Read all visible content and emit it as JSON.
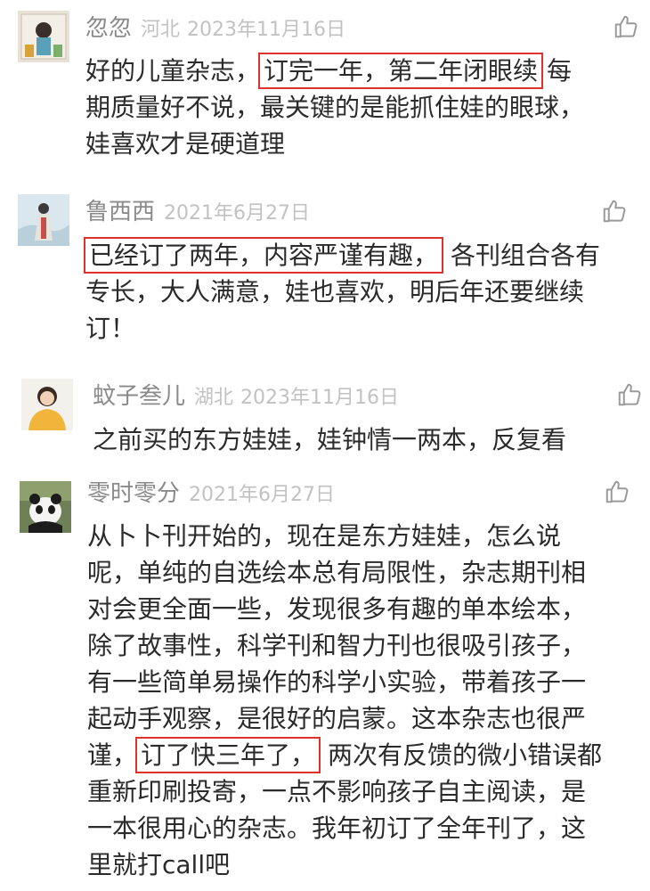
{
  "comments": [
    {
      "name": "忽忽",
      "location": "河北",
      "date": "2023年11月16日",
      "lines": [
        {
          "pre": "好的儿童杂志，",
          "hl": "订完一年，第二年闭眼续",
          "post": "每"
        },
        {
          "pre": "期质量好不说，最关键的是能抓住娃的眼球，",
          "hl": "",
          "post": ""
        },
        {
          "pre": "娃喜欢才是硬道理",
          "hl": "",
          "post": ""
        }
      ]
    },
    {
      "name": "鲁西西",
      "location": "",
      "date": "2021年6月27日",
      "lines": [
        {
          "pre": "",
          "hl": "已经订了两年，内容严谨有趣，",
          "post": "各刊组合各有"
        },
        {
          "pre": "专长，大人满意，娃也喜欢，明后年还要继续",
          "hl": "",
          "post": ""
        },
        {
          "pre": "订！",
          "hl": "",
          "post": ""
        }
      ]
    },
    {
      "name": "蚊子叁儿",
      "location": "湖北",
      "date": "2023年11月16日",
      "lines": [
        {
          "pre": "之前买的东方娃娃，娃钟情一两本，反复看",
          "hl": "",
          "post": ""
        }
      ]
    },
    {
      "name": "零时零分",
      "location": "",
      "date": "2021年6月27日",
      "lines": [
        {
          "pre": "从卜卜刊开始的，现在是东方娃娃，怎么说",
          "hl": "",
          "post": ""
        },
        {
          "pre": "呢，单纯的自选绘本总有局限性，杂志期刊相",
          "hl": "",
          "post": ""
        },
        {
          "pre": "对会更全面一些，发现很多有趣的单本绘本，",
          "hl": "",
          "post": ""
        },
        {
          "pre": "除了故事性，科学刊和智力刊也很吸引孩子，",
          "hl": "",
          "post": ""
        },
        {
          "pre": "有一些简单易操作的科学小实验，带着孩子一",
          "hl": "",
          "post": ""
        },
        {
          "pre": "起动手观察，是很好的启蒙。这本杂志也很严",
          "hl": "",
          "post": ""
        },
        {
          "pre": "谨，",
          "hl": "订了快三年了，",
          "post": "两次有反馈的微小错误都"
        },
        {
          "pre": "重新印刷投寄，一点不影响孩子自主阅读，是",
          "hl": "",
          "post": ""
        },
        {
          "pre": "一本很用心的杂志。我年初订了全年刊了，这",
          "hl": "",
          "post": ""
        },
        {
          "pre": "里就打call吧",
          "hl": "",
          "post": ""
        }
      ]
    }
  ],
  "icons": {
    "like": "thumbs-up-icon"
  },
  "colors": {
    "highlight_border": "#e0312b",
    "name": "#8a8a8a",
    "meta": "#c2c2c2",
    "body": "#2b2b2b"
  }
}
